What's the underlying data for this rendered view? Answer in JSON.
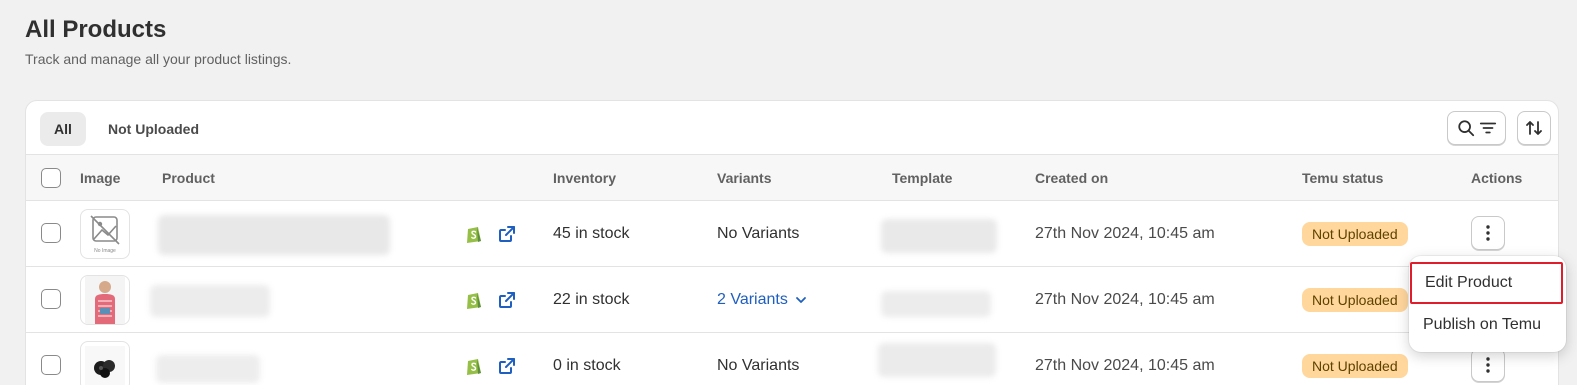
{
  "page": {
    "title": "All Products",
    "subtitle": "Track and manage all your product listings."
  },
  "tabs": [
    {
      "label": "All",
      "active": true
    },
    {
      "label": "Not Uploaded",
      "active": false
    }
  ],
  "toolbar": {
    "search_filter_icons": [
      "search-icon",
      "filter-icon"
    ],
    "sort_icon": "sort-icon"
  },
  "table": {
    "columns": [
      "Image",
      "Product",
      "Inventory",
      "Variants",
      "Template",
      "Created on",
      "Temu status",
      "Actions"
    ],
    "rows": [
      {
        "image": "No Image",
        "inventory": "45 in stock",
        "variants": "No Variants",
        "variants_is_link": false,
        "created_on": "27th Nov 2024, 10:45 am",
        "status": "Not Uploaded"
      },
      {
        "image": "person-photo",
        "inventory": "22 in stock",
        "variants": "2 Variants",
        "variants_is_link": true,
        "created_on": "27th Nov 2024, 10:45 am",
        "status": "Not Uploaded"
      },
      {
        "image": "product-photo",
        "inventory": "0 in stock",
        "variants": "No Variants",
        "variants_is_link": false,
        "created_on": "27th Nov 2024, 10:45 am",
        "status": "Not Uploaded"
      }
    ]
  },
  "dropdown": {
    "items": [
      "Edit Product",
      "Publish on Temu"
    ]
  },
  "colors": {
    "badge_bg": "#ffd79d",
    "badge_text": "#5e4200",
    "link": "#1f5fbf",
    "shopify_green": "#95bf47",
    "highlight": "#e01e2b"
  }
}
